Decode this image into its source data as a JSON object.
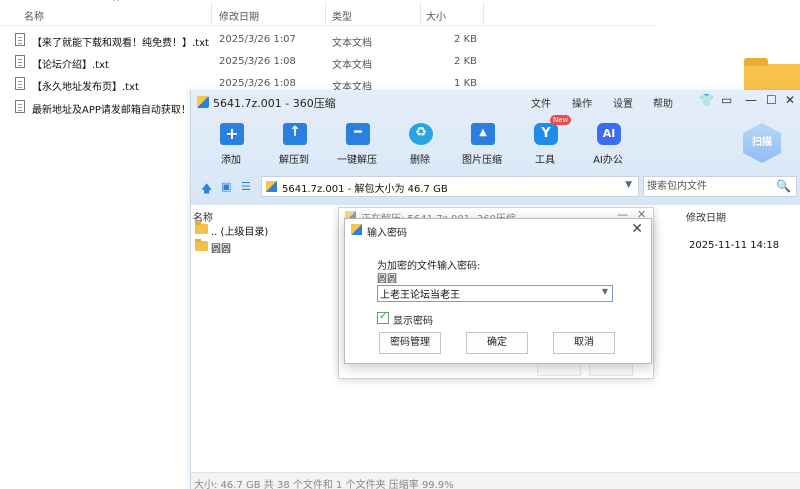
{
  "explorer": {
    "columns": {
      "name": "名称",
      "date": "修改日期",
      "type": "类型",
      "size": "大小"
    },
    "files": [
      {
        "name": "【来了就能下载和观看！纯免费！】.txt",
        "date": "2025/3/26 1:07",
        "type": "文本文档",
        "size": "2 KB"
      },
      {
        "name": "【论坛介绍】.txt",
        "date": "2025/3/26 1:08",
        "type": "文本文档",
        "size": "2 KB"
      },
      {
        "name": "【永久地址发布页】.txt",
        "date": "2025/3/26 1:08",
        "type": "文本文档",
        "size": "1 KB"
      },
      {
        "name": "最新地址及APP请发邮箱自动获取！！",
        "date": "",
        "type": "",
        "size": ""
      }
    ]
  },
  "zip": {
    "title": "5641.7z.001 - 360压缩",
    "menu": [
      "文件",
      "操作",
      "设置",
      "帮助"
    ],
    "toolbar": [
      {
        "label": "添加",
        "icon": "add-icon"
      },
      {
        "label": "解压到",
        "icon": "extract-icon"
      },
      {
        "label": "一键解压",
        "icon": "one-click-extract-icon"
      },
      {
        "label": "删除",
        "icon": "delete-icon"
      },
      {
        "label": "图片压缩",
        "icon": "image-compress-icon"
      },
      {
        "label": "工具",
        "icon": "tools-icon",
        "badge": "New"
      },
      {
        "label": "AI办公",
        "icon": "ai-icon"
      }
    ],
    "scan_label": "扫描",
    "path": "5641.7z.001 - 解包大小为 46.7 GB",
    "search_placeholder": "搜索包内文件",
    "list_columns": {
      "name": "名称",
      "date": "修改日期"
    },
    "rows": [
      {
        "name": ".. (上级目录)",
        "date": ""
      },
      {
        "name": "圆圆",
        "date": "2025-11-11 14:18"
      }
    ],
    "status": "大小: 46.7 GB 共 38 个文件和 1 个文件夹 压缩率 99.9%"
  },
  "progress_window": {
    "title": "正在解压: 5641.7z.001 -360压缩"
  },
  "password_dialog": {
    "title": "输入密码",
    "prompt": "为加密的文件输入密码:",
    "filename": "圆圆",
    "password": "上老王论坛当老王",
    "show_password_label": "显示密码",
    "show_password_checked": true,
    "buttons": {
      "manage": "密码管理",
      "ok": "确定",
      "cancel": "取消"
    }
  }
}
